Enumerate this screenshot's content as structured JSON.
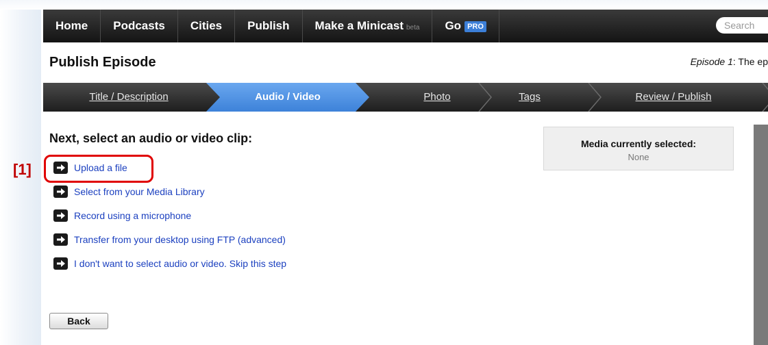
{
  "nav": {
    "items": [
      "Home",
      "Podcasts",
      "Cities",
      "Publish"
    ],
    "minicast_label": "Make a Minicast",
    "minicast_badge": "beta",
    "gopro_label": "Go",
    "gopro_badge": "PRO",
    "search_placeholder": "Search"
  },
  "page": {
    "title": "Publish Episode",
    "episode_prefix": "Episode 1",
    "episode_rest": ": The ep"
  },
  "steps": [
    {
      "label": "Title / Description",
      "active": false
    },
    {
      "label": "Audio / Video",
      "active": true
    },
    {
      "label": "Photo",
      "active": false
    },
    {
      "label": "Tags",
      "active": false
    },
    {
      "label": "Review / Publish",
      "active": false
    }
  ],
  "main": {
    "heading": "Next, select an audio or video clip:",
    "options": [
      "Upload a file",
      "Select from your Media Library",
      "Record using a microphone",
      "Transfer from your desktop using FTP (advanced)",
      "I don't want to select audio or video.  Skip this step"
    ],
    "back_label": "Back"
  },
  "media_box": {
    "title": "Media currently selected:",
    "value": "None"
  },
  "annotation": {
    "label": "[1]",
    "color": "#e00000"
  }
}
